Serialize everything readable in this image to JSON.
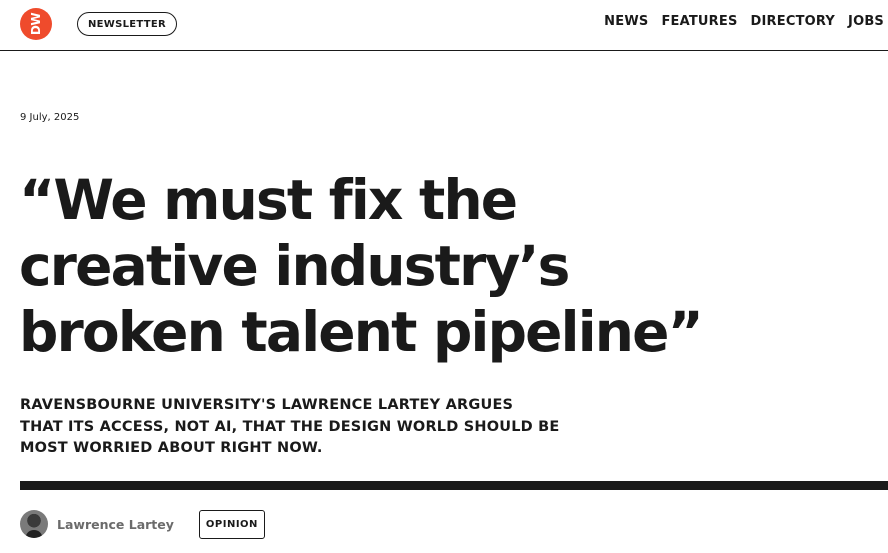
{
  "header": {
    "logo_text": "DW",
    "newsletter_label": "NEWSLETTER",
    "nav": [
      "NEWS",
      "FEATURES",
      "DIRECTORY",
      "JOBS"
    ]
  },
  "article": {
    "date": "9 July, 2025",
    "headline_lines": [
      "“We must fix the",
      "creative industry’s",
      "broken talent pipeline”"
    ],
    "standfirst_lines": [
      "RAVENSBOURNE UNIVERSITY'S LAWRENCE LARTEY ARGUES",
      "THAT ITS ACCESS, NOT AI, THAT THE DESIGN WORLD SHOULD BE",
      "MOST WORRIED ABOUT RIGHT NOW."
    ],
    "author": "Lawrence Lartey",
    "tag": "OPINION"
  },
  "colors": {
    "brand": "#ef4b2c",
    "text": "#1a1a1a",
    "muted": "#6b6b6b"
  }
}
